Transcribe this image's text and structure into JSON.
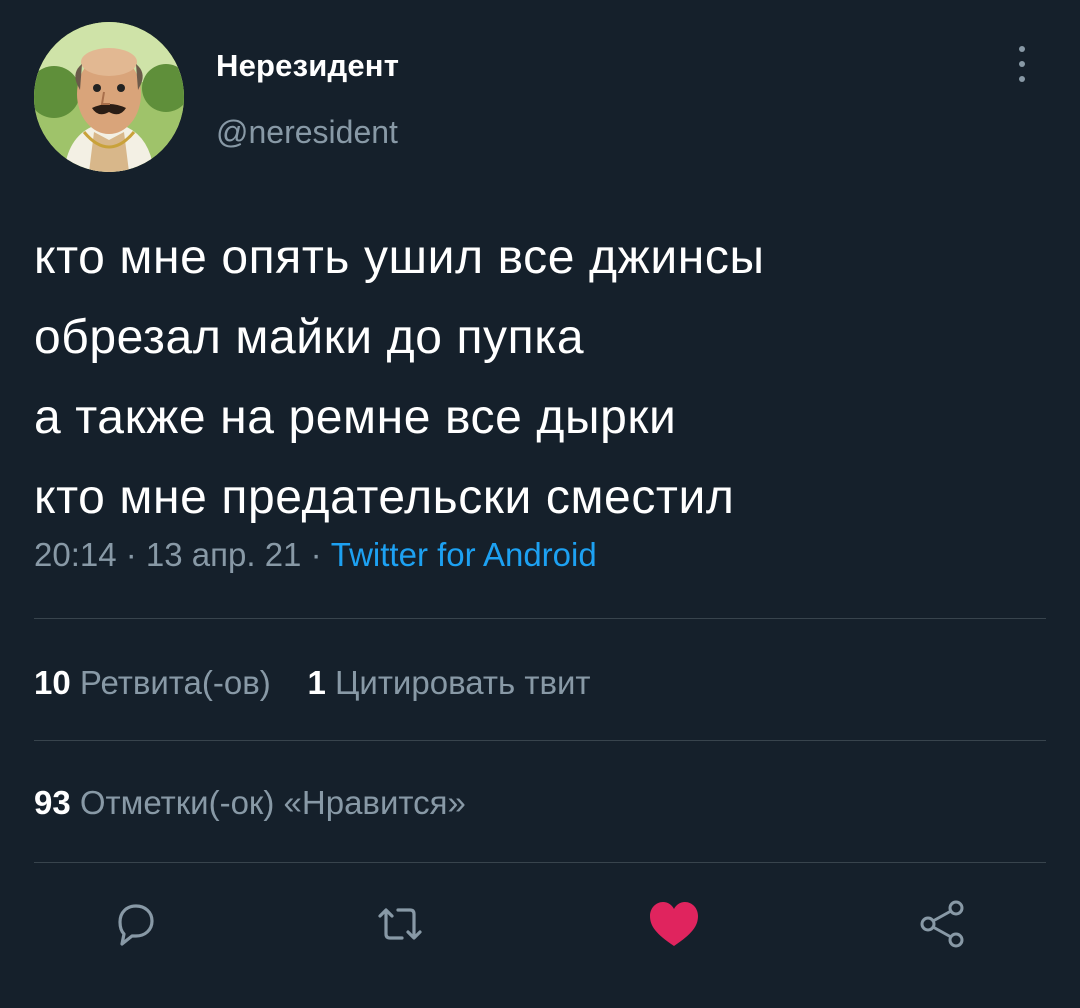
{
  "author": {
    "display_name": "Нерезидент",
    "handle": "@neresident"
  },
  "tweet": {
    "lines": [
      "кто мне опять ушил все джинсы",
      "обрезал майки до пупка",
      "а также на ремне все дырки",
      "кто мне предательски сместил"
    ],
    "time": "20:14",
    "sep1": " · ",
    "date": "13 апр. 21",
    "sep2": " · ",
    "source": "Twitter for Android"
  },
  "stats": {
    "retweets_count": "10",
    "retweets_label": "Ретвита(-ов)",
    "quotes_count": "1",
    "quotes_label": "Цитировать твит",
    "likes_count": "93",
    "likes_label": "Отметки(-ок) «Нравится»"
  },
  "actions": {
    "reply_icon": "reply-icon",
    "retweet_icon": "retweet-icon",
    "like_icon": "heart-icon",
    "share_icon": "share-icon",
    "like_active": true
  },
  "colors": {
    "background": "#15202b",
    "secondary_text": "#8899a6",
    "link": "#1da1f2",
    "like": "#e0245e",
    "divider": "#38444d"
  }
}
